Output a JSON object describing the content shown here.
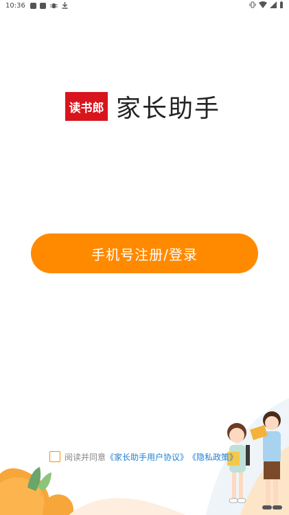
{
  "status_bar": {
    "time": "10:36"
  },
  "brand": {
    "logo_text": "读书郎",
    "logo_color": "#d8141c",
    "app_name": "家长助手"
  },
  "login": {
    "button_label": "手机号注册/登录",
    "button_color": "#ff8a00"
  },
  "agreement": {
    "prefix": "阅读并同意",
    "user_agreement": "《家长助手用户协议》",
    "privacy_policy": "《隐私政策》",
    "checked": false
  }
}
